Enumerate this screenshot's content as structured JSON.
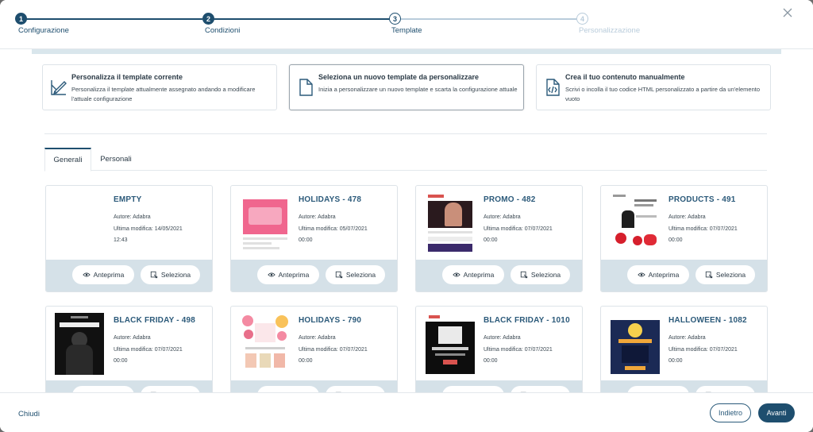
{
  "colors": {
    "primary": "#1e4e6e",
    "step_future": "#b9ccdb",
    "card_actions_bg": "#d5e1e8",
    "title_blue": "#2c5a7a"
  },
  "stepper": {
    "steps": [
      {
        "number": "1",
        "label": "Configurazione",
        "state": "done"
      },
      {
        "number": "2",
        "label": "Condizioni",
        "state": "done"
      },
      {
        "number": "3",
        "label": "Template",
        "state": "current"
      },
      {
        "number": "4",
        "label": "Personalizzazione",
        "state": "future"
      }
    ],
    "close_icon": "close-icon"
  },
  "options": [
    {
      "title": "Personalizza il template corrente",
      "desc": "Personalizza il template attualmente assegnato andando a modificare l'attuale configurazione",
      "icon": "edit-template-icon",
      "selected": false
    },
    {
      "title": "Seleziona un nuovo template da personalizzare",
      "desc": "Inizia a personalizzare un nuovo template e scarta la configurazione attuale",
      "icon": "document-icon",
      "selected": true
    },
    {
      "title": "Crea il tuo contenuto manualmente",
      "desc": "Scrivi o incolla il tuo codice HTML personalizzato a partire da un'elemento vuoto",
      "icon": "code-file-icon",
      "selected": false
    }
  ],
  "tabs": [
    {
      "label": "Generali",
      "active": true
    },
    {
      "label": "Personali",
      "active": false
    }
  ],
  "template_labels": {
    "preview": "Anteprima",
    "select": "Seleziona"
  },
  "templates": [
    {
      "name": "EMPTY",
      "author": "Autore: Adabra",
      "modified": "Ultima modifica: 14/05/2021",
      "time": "12:43",
      "thumb": "empty"
    },
    {
      "name": "HOLIDAYS - 478",
      "author": "Autore: Adabra",
      "modified": "Ultima modifica: 05/07/2021",
      "time": "00:00",
      "thumb": "holidays478"
    },
    {
      "name": "PROMO - 482",
      "author": "Autore: Adabra",
      "modified": "Ultima modifica: 07/07/2021",
      "time": "00:00",
      "thumb": "promo482"
    },
    {
      "name": "PRODUCTS - 491",
      "author": "Autore: Adabra",
      "modified": "Ultima modifica: 07/07/2021",
      "time": "00:00",
      "thumb": "products491"
    },
    {
      "name": "BLACK FRIDAY - 498",
      "author": "Autore: Adabra",
      "modified": "Ultima modifica: 07/07/2021",
      "time": "00:00",
      "thumb": "bf498"
    },
    {
      "name": "HOLIDAYS - 790",
      "author": "Autore: Adabra",
      "modified": "Ultima modifica: 07/07/2021",
      "time": "00:00",
      "thumb": "holidays790"
    },
    {
      "name": "BLACK FRIDAY - 1010",
      "author": "Autore: Adabra",
      "modified": "Ultima modifica: 07/07/2021",
      "time": "00:00",
      "thumb": "bf1010"
    },
    {
      "name": "HALLOWEEN - 1082",
      "author": "Autore: Adabra",
      "modified": "Ultima modifica: 07/07/2021",
      "time": "00:00",
      "thumb": "halloween1082"
    }
  ],
  "footer": {
    "close_label": "Chiudi",
    "back_label": "Indietro",
    "next_label": "Avanti"
  }
}
